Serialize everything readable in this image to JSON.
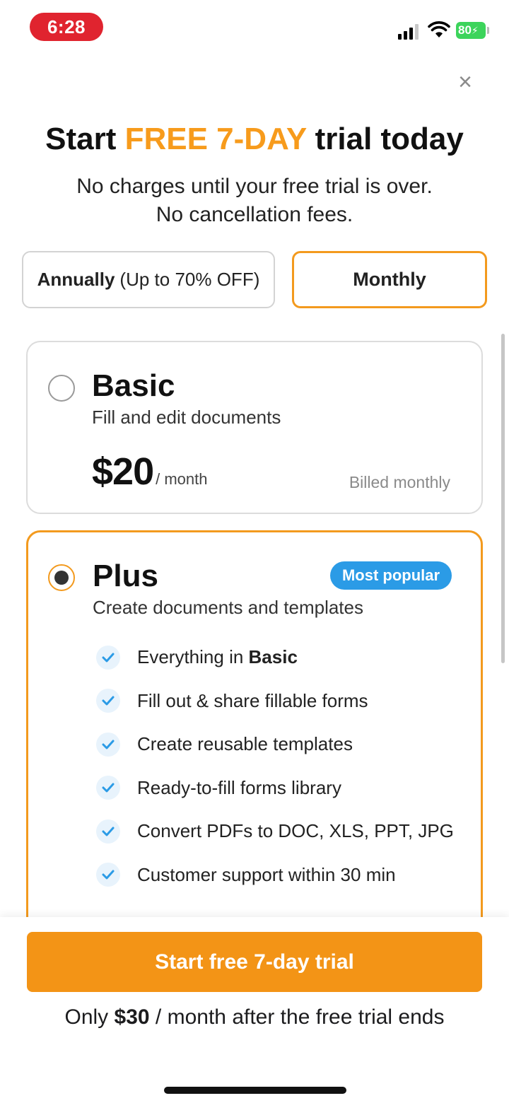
{
  "status_bar": {
    "time": "6:28",
    "battery": "80",
    "icons": [
      "signal-icon",
      "wifi-icon",
      "battery-icon"
    ]
  },
  "close_icon": "×",
  "headline": {
    "prefix": "Start ",
    "highlight": "FREE 7-DAY",
    "suffix": " trial today",
    "highlight_color": "#F79B1C"
  },
  "subline": {
    "line1": "No charges until your free trial is over.",
    "line2": "No cancellation fees."
  },
  "billing_toggle": {
    "annual_label": "Annually",
    "annual_note": "(Up to 70% OFF)",
    "monthly_label": "Monthly",
    "selected": "Monthly"
  },
  "plans": {
    "basic": {
      "name": "Basic",
      "description": "Fill and edit documents",
      "price": "$20",
      "period": "/ month",
      "billing": "Billed monthly",
      "selected": false
    },
    "plus": {
      "name": "Plus",
      "description": "Create documents and templates",
      "badge": "Most popular",
      "selected": true,
      "features": [
        {
          "prefix": "Everything in ",
          "bold": "Basic"
        },
        {
          "prefix": "Fill out & share fillable forms",
          "bold": ""
        },
        {
          "prefix": "Create reusable templates",
          "bold": ""
        },
        {
          "prefix": "Ready-to-fill forms library",
          "bold": ""
        },
        {
          "prefix": "Convert PDFs to DOC, XLS, PPT, JPG",
          "bold": ""
        },
        {
          "prefix": "Customer support within 30 min",
          "bold": ""
        }
      ]
    }
  },
  "cta": {
    "label": "Start free 7-day trial",
    "note_prefix": "Only ",
    "note_price": "$30",
    "note_suffix": " / month after the free trial ends"
  },
  "colors": {
    "accent": "#F39416",
    "badge": "#2B9BE6",
    "check": "#2B9BE6",
    "time_pill": "#E0242F",
    "battery": "#3CD45B"
  }
}
